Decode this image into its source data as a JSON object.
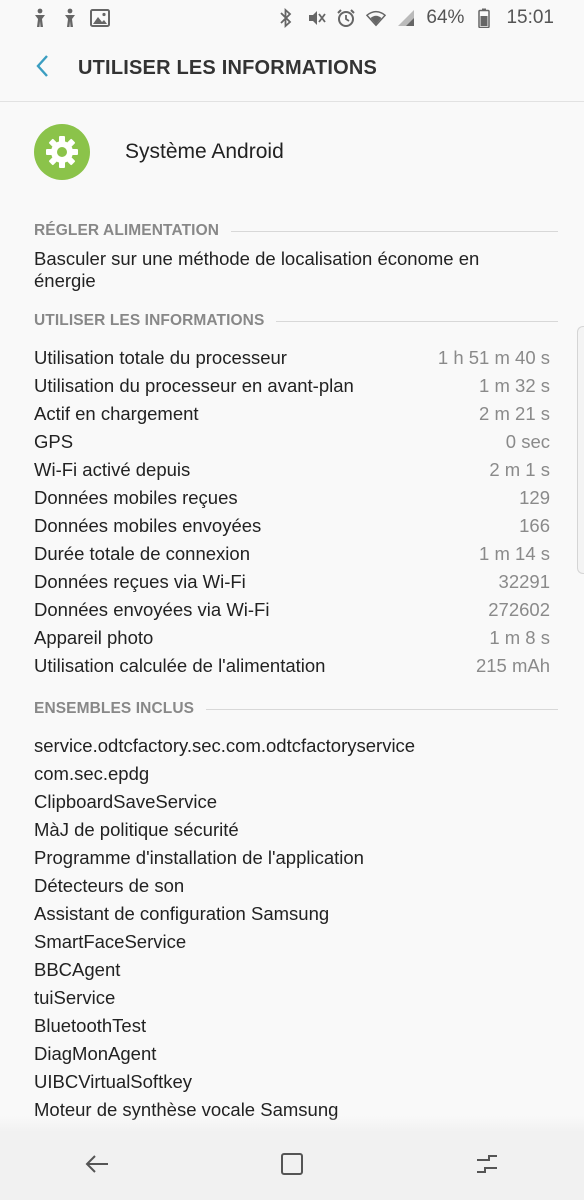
{
  "status_bar": {
    "left_icons": [
      "accessibility-icon",
      "accessibility-icon",
      "image-icon"
    ],
    "right_icons": [
      "bluetooth-icon",
      "mute-icon",
      "alarm-icon",
      "wifi-icon",
      "signal-icon",
      "battery-icon"
    ],
    "battery": "64%",
    "time": "15:01"
  },
  "header": {
    "title": "UTILISER LES INFORMATIONS",
    "back_icon": "chevron-left-icon"
  },
  "app": {
    "name": "Système Android",
    "icon": "gear-icon",
    "icon_color": "#8bc34a"
  },
  "power_section": {
    "title": "RÉGLER ALIMENTATION",
    "text": "Basculer sur une méthode de localisation économe en énergie"
  },
  "usage_section": {
    "title": "UTILISER LES INFORMATIONS",
    "rows": [
      {
        "label": "Utilisation totale du processeur",
        "value": "1 h 51 m 40 s"
      },
      {
        "label": "Utilisation du processeur en avant-plan",
        "value": "1 m 32 s"
      },
      {
        "label": "Actif en chargement",
        "value": "2 m 21 s"
      },
      {
        "label": "GPS",
        "value": "0 sec"
      },
      {
        "label": "Wi-Fi activé depuis",
        "value": "2 m 1 s"
      },
      {
        "label": "Données mobiles reçues",
        "value": "129"
      },
      {
        "label": "Données mobiles envoyées",
        "value": "166"
      },
      {
        "label": "Durée totale de connexion",
        "value": "1 m 14 s"
      },
      {
        "label": "Données reçues via Wi-Fi",
        "value": "32291"
      },
      {
        "label": "Données envoyées via Wi-Fi",
        "value": "272602"
      },
      {
        "label": "Appareil photo",
        "value": "1 m 8 s"
      },
      {
        "label": "Utilisation calculée de l'alimentation",
        "value": "215 mAh"
      }
    ]
  },
  "packages_section": {
    "title": "ENSEMBLES INCLUS",
    "items": [
      "service.odtcfactory.sec.com.odtcfactoryservice",
      "com.sec.epdg",
      "ClipboardSaveService",
      "MàJ de politique sécurité",
      "Programme d'installation de l'application",
      "Détecteurs de son",
      "Assistant de configuration Samsung",
      "SmartFaceService",
      "BBCAgent",
      "tuiService",
      "BluetoothTest",
      "DiagMonAgent",
      "UIBCVirtualSoftkey",
      "Moteur de synthèse vocale Samsung"
    ]
  },
  "nav_bar": {
    "buttons": [
      "back-icon",
      "home-icon",
      "recents-icon"
    ]
  },
  "colors": {
    "accent": "#3b9ec1",
    "background": "#f9f9f9",
    "section_title": "#888888",
    "value_text": "#8a8a8a"
  }
}
